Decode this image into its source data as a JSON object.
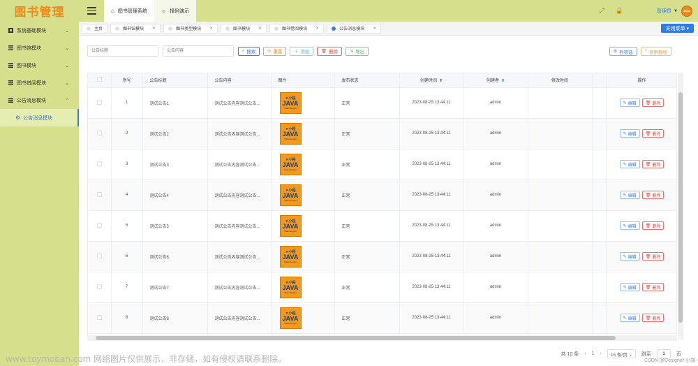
{
  "app": {
    "logo_text": "图书管理"
  },
  "header": {
    "tabs": [
      {
        "label": "图书管理系统",
        "icon": "home-icon"
      },
      {
        "label": "择例演示",
        "icon": "bulb-icon"
      }
    ],
    "user_name": "管理员",
    "avatar_text": "JAVA"
  },
  "sidebar": {
    "items": [
      {
        "label": "系统基础模块"
      },
      {
        "label": "图书馆模块"
      },
      {
        "label": "图书模块"
      },
      {
        "label": "图书借阅模块"
      },
      {
        "label": "公告消息模块"
      }
    ],
    "sub_item": {
      "label": "公告消息模块"
    }
  },
  "tags": [
    {
      "label": "主页",
      "closable": false
    },
    {
      "label": "图书馆模块",
      "closable": true
    },
    {
      "label": "图书类型模块",
      "closable": true
    },
    {
      "label": "图书模块",
      "closable": true
    },
    {
      "label": "图书借阅模块",
      "closable": true
    },
    {
      "label": "公告消息模块",
      "closable": true,
      "active": true
    }
  ],
  "close_menu": "关闭菜单",
  "search": {
    "title_placeholder": "公告标题",
    "content_placeholder": "公告内容"
  },
  "toolbar": {
    "search": "搜索",
    "reset": "重置",
    "add": "添加",
    "delete": "删除",
    "export": "导出",
    "columns": "列筛选",
    "guide": "使用教程"
  },
  "table": {
    "columns": [
      "序号",
      "公告标题",
      "公告内容",
      "图片",
      "发布状态",
      "创建时间",
      "创建者",
      "修改时间",
      "操作"
    ],
    "thumb": {
      "line1": "▼小程",
      "line2": "JAVA",
      "line3": "Xiaochengxu"
    },
    "rows": [
      {
        "no": "1",
        "title": "测试公告1",
        "content": "测试公告内容测试公告...",
        "status": "正常",
        "created": "2023-08-25 13:44:11",
        "creator": "admin",
        "modified": ""
      },
      {
        "no": "2",
        "title": "测试公告2",
        "content": "测试公告内容测试公告...",
        "status": "正常",
        "created": "2023-08-25 13:44:11",
        "creator": "admin",
        "modified": ""
      },
      {
        "no": "3",
        "title": "测试公告3",
        "content": "测试公告内容测试公告...",
        "status": "正常",
        "created": "2023-08-25 13:44:11",
        "creator": "admin",
        "modified": ""
      },
      {
        "no": "4",
        "title": "测试公告4",
        "content": "测试公告内容测试公告...",
        "status": "正常",
        "created": "2023-08-25 13:44:11",
        "creator": "admin",
        "modified": ""
      },
      {
        "no": "5",
        "title": "测试公告5",
        "content": "测试公告内容测试公告...",
        "status": "正常",
        "created": "2023-08-25 13:44:11",
        "creator": "admin",
        "modified": ""
      },
      {
        "no": "6",
        "title": "测试公告6",
        "content": "测试公告内容测试公告...",
        "status": "正常",
        "created": "2023-08-25 13:44:11",
        "creator": "admin",
        "modified": ""
      },
      {
        "no": "7",
        "title": "测试公告7",
        "content": "测试公告内容测试公告...",
        "status": "正常",
        "created": "2023-08-25 13:44:11",
        "creator": "admin",
        "modified": ""
      },
      {
        "no": "8",
        "title": "测试公告8",
        "content": "测试公告内容测试公告...",
        "status": "正常",
        "created": "2023-08-25 13:44:11",
        "creator": "admin",
        "modified": ""
      }
    ],
    "edit_label": "编辑",
    "delete_label": "删除"
  },
  "pagination": {
    "total": "共 10 条",
    "current": "1",
    "page_size": "15 条/页",
    "goto_label": "跳至",
    "goto_value": "1",
    "page_unit": "页"
  },
  "watermark": "www.toymoban.com 网络图片仅供展示，非存储，如有侵权请联系删除。",
  "credit": "CSDN @Designer 小郑",
  "colors": {
    "accent": "#3a7bd5",
    "sidebar_bg": "#d6df8c",
    "logo": "#f08a1a",
    "danger": "#f56c6c"
  }
}
